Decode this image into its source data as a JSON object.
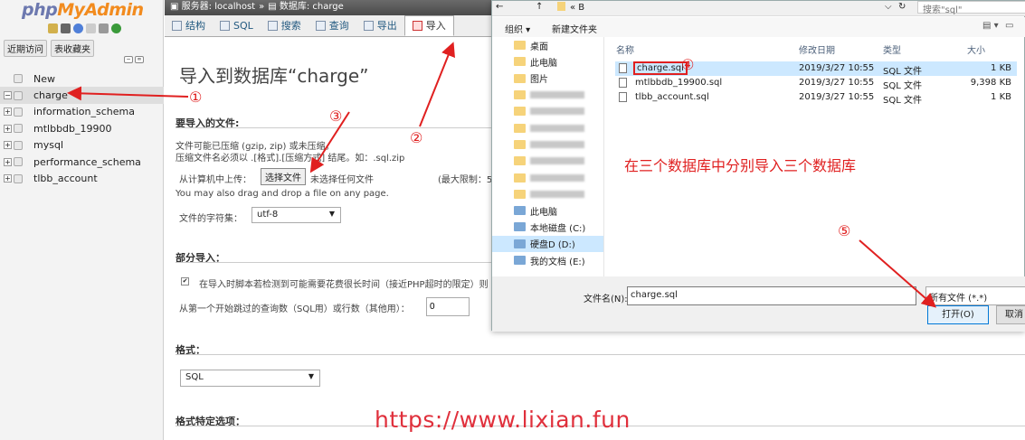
{
  "sidebar": {
    "logo_php": "php",
    "logo_admin": "MyAdmin",
    "tabs": [
      "近期访问",
      "表收藏夹"
    ],
    "new_label": "New",
    "databases": [
      "charge",
      "information_schema",
      "mtlbbdb_19900",
      "mysql",
      "performance_schema",
      "tlbb_account"
    ]
  },
  "breadcrumb": {
    "server": "服务器: localhost",
    "database": "数据库: charge"
  },
  "tabs": [
    {
      "label": "结构"
    },
    {
      "label": "SQL"
    },
    {
      "label": "搜索"
    },
    {
      "label": "查询"
    },
    {
      "label": "导出"
    },
    {
      "label": "导入"
    }
  ],
  "main": {
    "title": "导入到数据库“charge”",
    "file_section": "要导入的文件:",
    "compress_line1": "文件可能已压缩 (gzip, zip) 或未压缩。",
    "compress_line2": "压缩文件名必须以 .[格式].[压缩方式] 结尾。如：.sql.zip",
    "upload_label": "从计算机中上传：",
    "choose_file": "选择文件",
    "no_file": "未选择任何文件",
    "max_limit": "(最大限制：5",
    "drag_text": "You may also drag and drop a file on any page.",
    "charset_label": "文件的字符集：",
    "charset_value": "utf-8",
    "partial_section": "部分导入：",
    "partial_check_text": "在导入时脚本若检测到可能需要花费很长时间（接近PHP超时的限定）则",
    "skip_label": "从第一个开始跳过的查询数（SQL用）或行数（其他用）：",
    "skip_value": "0",
    "format_section": "格式：",
    "format_value": "SQL",
    "format_options_section": "格式特定选项："
  },
  "dialog": {
    "address_path": "« B",
    "search_placeholder": "搜索\"sql\"",
    "organize": "组织 ▾",
    "new_folder": "新建文件夹",
    "nav": [
      {
        "label": "桌面",
        "blur": false
      },
      {
        "label": "此电脑",
        "blur": false
      },
      {
        "label": "图片",
        "blur": false
      },
      {
        "label": "",
        "blur": true
      },
      {
        "label": "",
        "blur": true
      },
      {
        "label": "",
        "blur": true
      },
      {
        "label": "",
        "blur": true
      },
      {
        "label": "",
        "blur": true
      },
      {
        "label": "",
        "blur": true
      },
      {
        "label": "",
        "blur": true
      },
      {
        "label": "此电脑",
        "blur": false
      },
      {
        "label": "本地磁盘 (C:)",
        "blur": false
      },
      {
        "label": "硬盘D (D:)",
        "blur": false,
        "selected": true
      },
      {
        "label": "我的文档 (E:)",
        "blur": false
      }
    ],
    "columns": [
      "名称",
      "修改日期",
      "类型",
      "大小"
    ],
    "files": [
      {
        "name": "charge.sql",
        "date": "2019/3/27 10:55",
        "type": "SQL 文件",
        "size": "1 KB"
      },
      {
        "name": "mtlbbdb_19900.sql",
        "date": "2019/3/27 10:55",
        "type": "SQL 文件",
        "size": "9,398 KB"
      },
      {
        "name": "tlbb_account.sql",
        "date": "2019/3/27 10:55",
        "type": "SQL 文件",
        "size": "1 KB"
      }
    ],
    "filename_label": "文件名(N):",
    "filename_value": "charge.sql",
    "filter_value": "所有文件 (*.*)",
    "open_button": "打开(O)",
    "cancel_button": "取消"
  },
  "annotations": {
    "n1": "①",
    "n2": "②",
    "n3": "③",
    "n4": "④",
    "n5": "⑤",
    "note": "在三个数据库中分别导入三个数据库",
    "watermark": "https://www.lixian.fun",
    "color": "#e02020"
  }
}
